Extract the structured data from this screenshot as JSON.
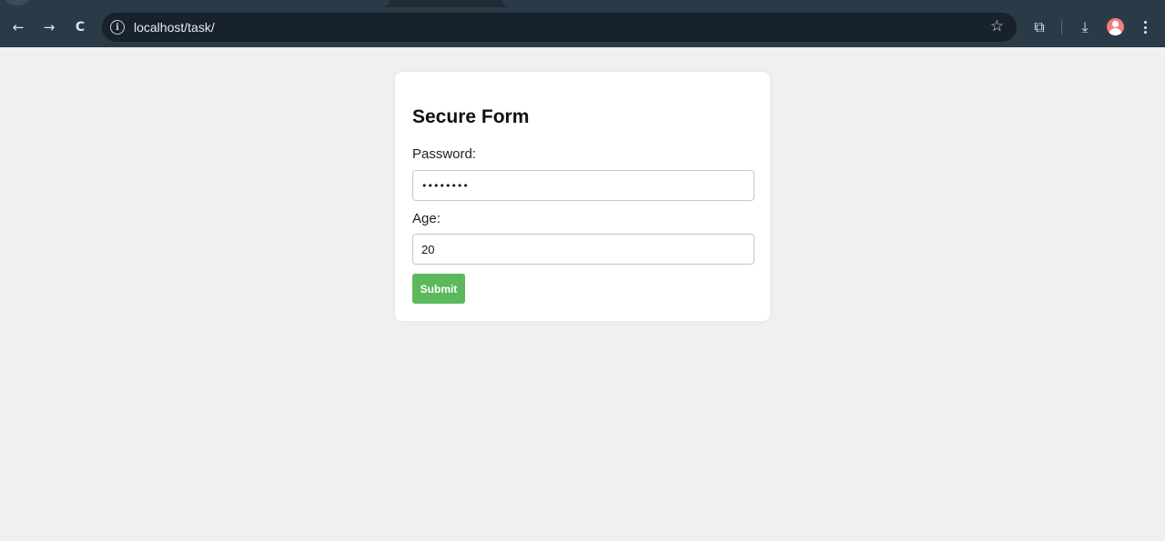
{
  "browser": {
    "url": "localhost/task/",
    "icons": {
      "back": "←",
      "forward": "→",
      "reload": "C",
      "info": "i",
      "star": "☆",
      "extensions": "⧉",
      "download": "⤓"
    }
  },
  "form": {
    "title": "Secure Form",
    "password_label": "Password:",
    "password_value": "••••••••",
    "age_label": "Age:",
    "age_value": "20",
    "submit_label": "Submit"
  },
  "colors": {
    "submit_bg": "#5cb85c",
    "page_bg": "#f0f0f0",
    "chrome_bg": "#2b3a47"
  }
}
